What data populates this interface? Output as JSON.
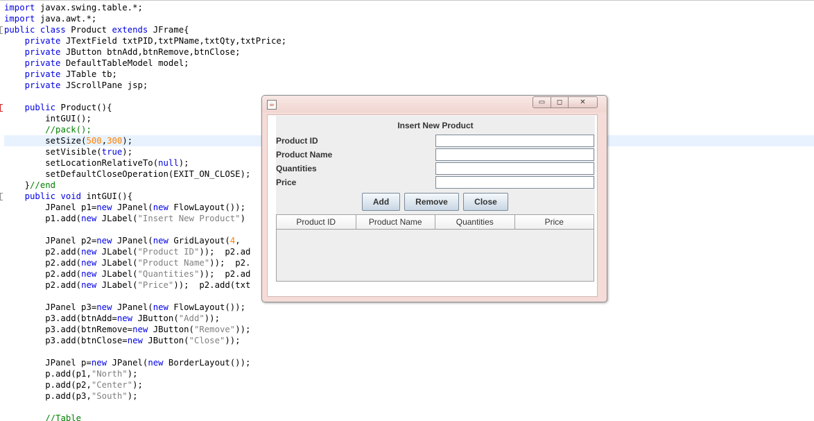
{
  "editor": {
    "lines": [
      [
        [
          "kw",
          "import"
        ],
        [
          "id",
          " javax.swing.table.*;"
        ]
      ],
      [
        [
          "kw",
          "import"
        ],
        [
          "id",
          " java.awt.*;"
        ]
      ],
      [
        [
          "kw",
          "public class"
        ],
        [
          "id",
          " Product "
        ],
        [
          "kw",
          "extends"
        ],
        [
          "id",
          " JFrame{"
        ]
      ],
      [
        [
          "id",
          "    "
        ],
        [
          "kw",
          "private"
        ],
        [
          "id",
          " JTextField txtPID,txtPName,txtQty,txtPrice;"
        ]
      ],
      [
        [
          "id",
          "    "
        ],
        [
          "kw",
          "private"
        ],
        [
          "id",
          " JButton btnAdd,btnRemove,btnClose;"
        ]
      ],
      [
        [
          "id",
          "    "
        ],
        [
          "kw",
          "private"
        ],
        [
          "id",
          " DefaultTableModel model;"
        ]
      ],
      [
        [
          "id",
          "    "
        ],
        [
          "kw",
          "private"
        ],
        [
          "id",
          " JTable tb;"
        ]
      ],
      [
        [
          "id",
          "    "
        ],
        [
          "kw",
          "private"
        ],
        [
          "id",
          " JScrollPane jsp;"
        ]
      ],
      [],
      [
        [
          "id",
          "    "
        ],
        [
          "kw",
          "public"
        ],
        [
          "id",
          " Product(){"
        ]
      ],
      [
        [
          "id",
          "        intGUI();"
        ]
      ],
      [
        [
          "id",
          "        "
        ],
        [
          "cmt",
          "//pack();"
        ]
      ],
      [
        [
          "id",
          "        setSize("
        ],
        [
          "num",
          "500"
        ],
        [
          "id",
          ","
        ],
        [
          "num",
          "300"
        ],
        [
          "id",
          ");"
        ]
      ],
      [
        [
          "id",
          "        setVisible("
        ],
        [
          "kw",
          "true"
        ],
        [
          "id",
          ");"
        ]
      ],
      [
        [
          "id",
          "        setLocationRelativeTo("
        ],
        [
          "kw",
          "null"
        ],
        [
          "id",
          ");"
        ]
      ],
      [
        [
          "id",
          "        setDefaultCloseOperation(EXIT_ON_CLOSE);"
        ]
      ],
      [
        [
          "id",
          "    }"
        ],
        [
          "cmt",
          "//end"
        ]
      ],
      [
        [
          "id",
          "    "
        ],
        [
          "kw",
          "public void"
        ],
        [
          "id",
          " intGUI(){"
        ]
      ],
      [
        [
          "id",
          "        JPanel p1="
        ],
        [
          "kw",
          "new"
        ],
        [
          "id",
          " JPanel("
        ],
        [
          "kw",
          "new"
        ],
        [
          "id",
          " FlowLayout());"
        ]
      ],
      [
        [
          "id",
          "        p1.add("
        ],
        [
          "kw",
          "new"
        ],
        [
          "id",
          " JLabel("
        ],
        [
          "str",
          "\"Insert New Product\""
        ],
        [
          "id",
          ")"
        ]
      ],
      [],
      [
        [
          "id",
          "        JPanel p2="
        ],
        [
          "kw",
          "new"
        ],
        [
          "id",
          " JPanel("
        ],
        [
          "kw",
          "new"
        ],
        [
          "id",
          " GridLayout("
        ],
        [
          "num",
          "4"
        ],
        [
          "id",
          ","
        ]
      ],
      [
        [
          "id",
          "        p2.add("
        ],
        [
          "kw",
          "new"
        ],
        [
          "id",
          " JLabel("
        ],
        [
          "str",
          "\"Product ID\""
        ],
        [
          "id",
          "));  p2.ad"
        ]
      ],
      [
        [
          "id",
          "        p2.add("
        ],
        [
          "kw",
          "new"
        ],
        [
          "id",
          " JLabel("
        ],
        [
          "str",
          "\"Product Name\""
        ],
        [
          "id",
          "));  p2."
        ]
      ],
      [
        [
          "id",
          "        p2.add("
        ],
        [
          "kw",
          "new"
        ],
        [
          "id",
          " JLabel("
        ],
        [
          "str",
          "\"Quantities\""
        ],
        [
          "id",
          "));  p2.ad"
        ]
      ],
      [
        [
          "id",
          "        p2.add("
        ],
        [
          "kw",
          "new"
        ],
        [
          "id",
          " JLabel("
        ],
        [
          "str",
          "\"Price\""
        ],
        [
          "id",
          "));  p2.add(txt"
        ]
      ],
      [],
      [
        [
          "id",
          "        JPanel p3="
        ],
        [
          "kw",
          "new"
        ],
        [
          "id",
          " JPanel("
        ],
        [
          "kw",
          "new"
        ],
        [
          "id",
          " FlowLayout());"
        ]
      ],
      [
        [
          "id",
          "        p3.add(btnAdd="
        ],
        [
          "kw",
          "new"
        ],
        [
          "id",
          " JButton("
        ],
        [
          "str",
          "\"Add\""
        ],
        [
          "id",
          "));"
        ]
      ],
      [
        [
          "id",
          "        p3.add(btnRemove="
        ],
        [
          "kw",
          "new"
        ],
        [
          "id",
          " JButton("
        ],
        [
          "str",
          "\"Remove\""
        ],
        [
          "id",
          "));"
        ]
      ],
      [
        [
          "id",
          "        p3.add(btnClose="
        ],
        [
          "kw",
          "new"
        ],
        [
          "id",
          " JButton("
        ],
        [
          "str",
          "\"Close\""
        ],
        [
          "id",
          "));"
        ]
      ],
      [],
      [
        [
          "id",
          "        JPanel p="
        ],
        [
          "kw",
          "new"
        ],
        [
          "id",
          " JPanel("
        ],
        [
          "kw",
          "new"
        ],
        [
          "id",
          " BorderLayout());"
        ]
      ],
      [
        [
          "id",
          "        p.add(p1,"
        ],
        [
          "str",
          "\"North\""
        ],
        [
          "id",
          ");"
        ]
      ],
      [
        [
          "id",
          "        p.add(p2,"
        ],
        [
          "str",
          "\"Center\""
        ],
        [
          "id",
          ");"
        ]
      ],
      [
        [
          "id",
          "        p.add(p3,"
        ],
        [
          "str",
          "\"South\""
        ],
        [
          "id",
          ");"
        ]
      ],
      [],
      [
        [
          "id",
          "        "
        ],
        [
          "cmt",
          "//Table"
        ]
      ]
    ],
    "highlighted_line": 12
  },
  "window": {
    "icon_glyph": "☕",
    "min_glyph": "▭",
    "max_glyph": "◻",
    "close_glyph": "✕",
    "panel_title": "Insert New Product",
    "fields": [
      {
        "label": "Product ID",
        "value": ""
      },
      {
        "label": "Product Name",
        "value": ""
      },
      {
        "label": "Quantities",
        "value": ""
      },
      {
        "label": "Price",
        "value": ""
      }
    ],
    "buttons": {
      "add": "Add",
      "remove": "Remove",
      "close": "Close"
    },
    "table": {
      "columns": [
        "Product ID",
        "Product Name",
        "Quantities",
        "Price"
      ],
      "rows": []
    }
  },
  "colors": {
    "keyword": "#0000e6",
    "string": "#808080",
    "number": "#ff8000",
    "comment": "#008000",
    "line_highlight": "#e8f2fe",
    "window_frame": "#f5dcd8"
  }
}
